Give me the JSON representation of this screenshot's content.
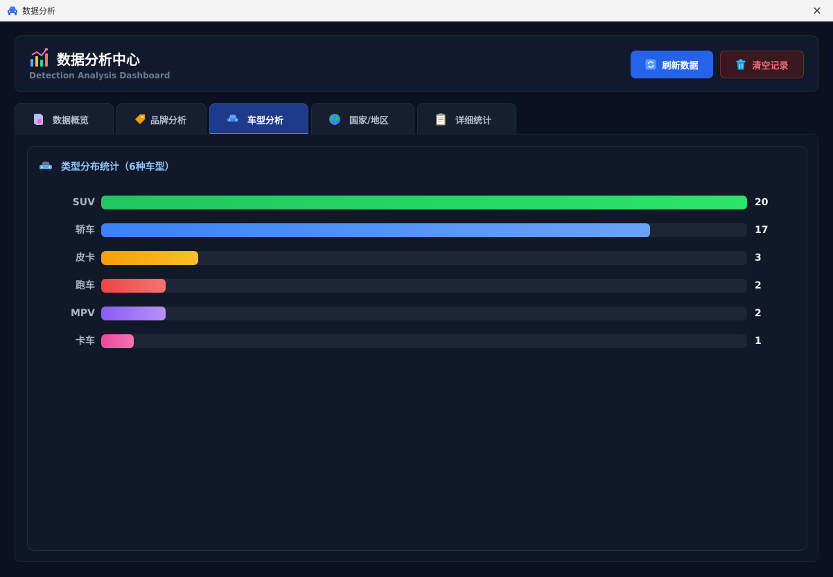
{
  "window": {
    "title": "数据分析",
    "close_glyph": "✕"
  },
  "header": {
    "title": "数据分析中心",
    "subtitle": "Detection Analysis Dashboard",
    "icon": "bar-chart-icon",
    "refresh_label": "刷新数据",
    "refresh_icon": "refresh-icon",
    "clear_label": "清空记录",
    "clear_icon": "trash-icon"
  },
  "tabs": [
    {
      "label": "数据概览",
      "icon": "document-icon"
    },
    {
      "label": "品牌分析",
      "icon": "tag-icon"
    },
    {
      "label": "车型分析",
      "icon": "car-icon",
      "active": true
    },
    {
      "label": "国家/地区",
      "icon": "globe-icon"
    },
    {
      "label": "详细统计",
      "icon": "clipboard-icon"
    }
  ],
  "card": {
    "title": "类型分布统计（6种车型）",
    "icon": "car-icon"
  },
  "chart_data": {
    "type": "bar",
    "orientation": "horizontal",
    "title": "类型分布统计（6种车型）",
    "categories": [
      "SUV",
      "轿车",
      "皮卡",
      "跑车",
      "MPV",
      "卡车"
    ],
    "values": [
      20,
      17,
      3,
      2,
      2,
      1
    ],
    "xlim": [
      0,
      20
    ],
    "colors": [
      [
        "#22c55e",
        "#2be46a"
      ],
      [
        "#3b82f6",
        "#6aa2fa"
      ],
      [
        "#f59e0b",
        "#fbbf24"
      ],
      [
        "#ef4444",
        "#f87171"
      ],
      [
        "#8b5cf6",
        "#b591f9"
      ],
      [
        "#ec4899",
        "#f472b6"
      ]
    ],
    "track_color": "#1e2535"
  }
}
